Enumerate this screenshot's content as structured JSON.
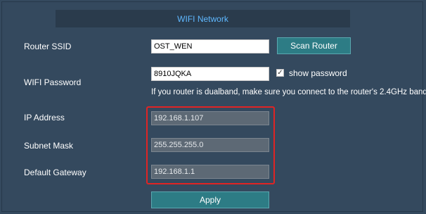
{
  "header": {
    "title": "WIFI Network"
  },
  "router_ssid": {
    "label": "Router SSID",
    "value": "OST_WEN"
  },
  "scan_button": {
    "label": "Scan Router"
  },
  "wifi_password": {
    "label": "WIFI Password",
    "value": "8910JQKA"
  },
  "show_password": {
    "label": "show password",
    "checked": true
  },
  "hint": {
    "text": "If you router is dualband, make sure you connect to the router's 2.4GHz band."
  },
  "ip_address": {
    "label": "IP Address",
    "value": "192.168.1.107"
  },
  "subnet_mask": {
    "label": "Subnet Mask",
    "value": "255.255.255.0"
  },
  "default_gateway": {
    "label": "Default Gateway",
    "value": "192.168.1.1"
  },
  "apply_button": {
    "label": "Apply"
  },
  "colors": {
    "background": "#34495e",
    "accent": "#5fb8ff",
    "button": "#2d7c85",
    "highlight": "#e02424"
  }
}
